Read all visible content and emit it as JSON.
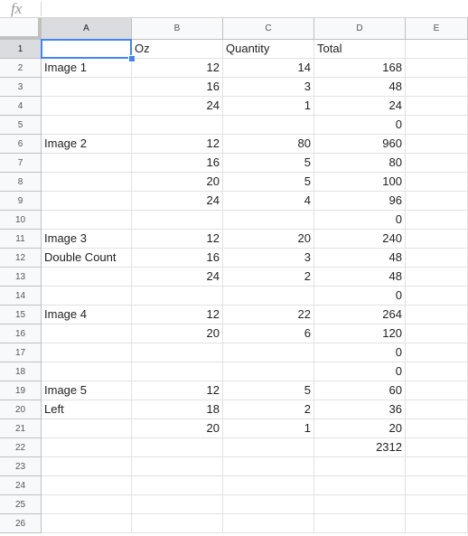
{
  "formula_bar": {
    "fx_label": "fx",
    "value": ""
  },
  "sheet": {
    "columns": [
      "A",
      "B",
      "C",
      "D",
      "E"
    ],
    "rows": [
      [
        "",
        "Oz",
        "Quantity",
        "Total",
        ""
      ],
      [
        "Image 1",
        "12",
        "14",
        "168",
        ""
      ],
      [
        "",
        "16",
        "3",
        "48",
        ""
      ],
      [
        "",
        "24",
        "1",
        "24",
        ""
      ],
      [
        "",
        "",
        "",
        "0",
        ""
      ],
      [
        "Image 2",
        "12",
        "80",
        "960",
        ""
      ],
      [
        "",
        "16",
        "5",
        "80",
        ""
      ],
      [
        "",
        "20",
        "5",
        "100",
        ""
      ],
      [
        "",
        "24",
        "4",
        "96",
        ""
      ],
      [
        "",
        "",
        "",
        "0",
        ""
      ],
      [
        "Image 3",
        "12",
        "20",
        "240",
        ""
      ],
      [
        "Double Count",
        "16",
        "3",
        "48",
        ""
      ],
      [
        "",
        "24",
        "2",
        "48",
        ""
      ],
      [
        "",
        "",
        "",
        "0",
        ""
      ],
      [
        "Image 4",
        "12",
        "22",
        "264",
        ""
      ],
      [
        "",
        "20",
        "6",
        "120",
        ""
      ],
      [
        "",
        "",
        "",
        "0",
        ""
      ],
      [
        "",
        "",
        "",
        "0",
        ""
      ],
      [
        "Image 5",
        "12",
        "5",
        "60",
        ""
      ],
      [
        "Left",
        "18",
        "2",
        "36",
        ""
      ],
      [
        "",
        "20",
        "1",
        "20",
        ""
      ],
      [
        "",
        "",
        "",
        "2312",
        ""
      ],
      [
        "",
        "",
        "",
        "",
        ""
      ],
      [
        "",
        "",
        "",
        "",
        ""
      ],
      [
        "",
        "",
        "",
        "",
        ""
      ],
      [
        "",
        "",
        "",
        "",
        ""
      ]
    ],
    "active_cell": "A1",
    "selected_column": "A",
    "selected_row": 1,
    "accent_color": "#4285f4"
  }
}
